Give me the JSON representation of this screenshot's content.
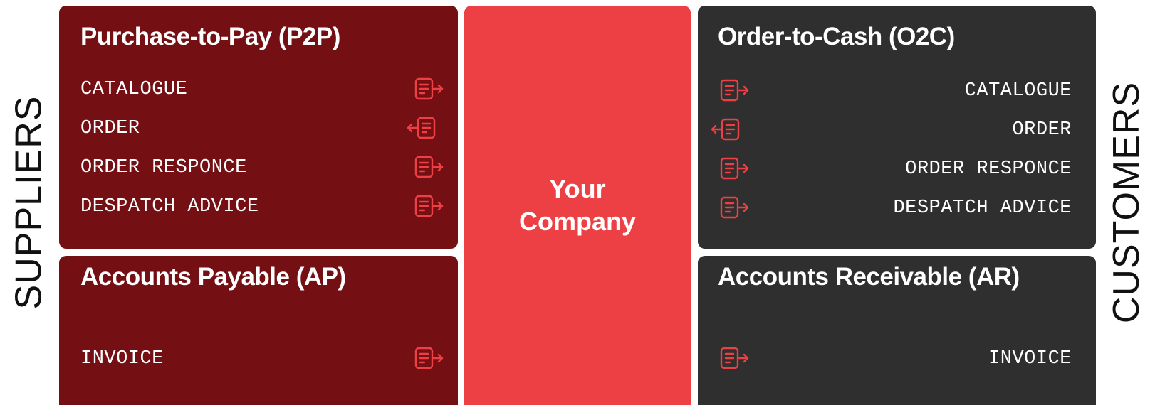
{
  "side_labels": {
    "left": "SUPPLIERS",
    "right": "CUSTOMERS"
  },
  "center": {
    "label": "Your Company",
    "color": "#ec4044"
  },
  "colors": {
    "supplier_panel": "#741014",
    "customer_panel": "#2f2f2f",
    "icon_accent": "#ec4044"
  },
  "p2p": {
    "title": "Purchase-to-Pay (P2P)",
    "items": [
      {
        "label": "CATALOGUE",
        "direction": "outgoing",
        "icon": "document-arrow-right-icon"
      },
      {
        "label": "ORDER",
        "direction": "incoming",
        "icon": "document-arrow-left-icon"
      },
      {
        "label": "ORDER RESPONCE",
        "direction": "outgoing",
        "icon": "document-arrow-right-icon"
      },
      {
        "label": "DESPATCH ADVICE",
        "direction": "outgoing",
        "icon": "document-arrow-right-icon"
      }
    ]
  },
  "ap": {
    "title": "Accounts Payable (AP)",
    "items": [
      {
        "label": "INVOICE",
        "direction": "outgoing",
        "icon": "document-arrow-right-icon"
      }
    ]
  },
  "o2c": {
    "title": "Order-to-Cash (O2C)",
    "items": [
      {
        "label": "CATALOGUE",
        "direction": "outgoing",
        "icon": "document-arrow-right-icon"
      },
      {
        "label": "ORDER",
        "direction": "incoming",
        "icon": "document-arrow-left-icon"
      },
      {
        "label": "ORDER RESPONCE",
        "direction": "outgoing",
        "icon": "document-arrow-right-icon"
      },
      {
        "label": "DESPATCH ADVICE",
        "direction": "outgoing",
        "icon": "document-arrow-right-icon"
      }
    ]
  },
  "ar": {
    "title": "Accounts Receivable (AR)",
    "items": [
      {
        "label": "INVOICE",
        "direction": "outgoing",
        "icon": "document-arrow-right-icon"
      }
    ]
  }
}
